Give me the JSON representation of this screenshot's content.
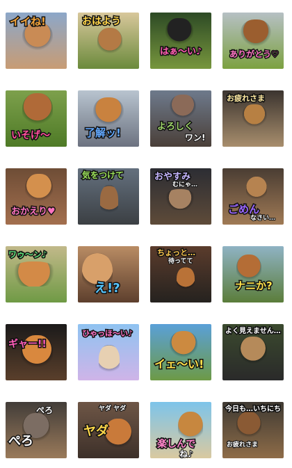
{
  "stickers": [
    {
      "text": "イイね!",
      "color": "#f3a43b",
      "bg": "linear-gradient(#8ca7c9,#c89c74)",
      "dogColor": "#c98b55"
    },
    {
      "text": "おはよう",
      "color": "#ffd54a",
      "bg": "linear-gradient(#d8c79b,#6b8a3c)",
      "dogColor": "#b47a45"
    },
    {
      "text": "はぁ〜い♪",
      "color": "#ff5db1",
      "bg": "linear-gradient(#2d4a25,#77963d)",
      "dogColor": "#222222"
    },
    {
      "text": "ありがとう♡",
      "color": "#ff75c5",
      "bg": "linear-gradient(#b6c0c4,#7ca140)",
      "dogColor": "#9b5e2f"
    },
    {
      "text": "いそげ〜",
      "color": "#ff4f9b",
      "bg": "linear-gradient(#7da04c,#4e7a26)",
      "dogColor": "#b06a38"
    },
    {
      "text": "了解ッ!",
      "color": "#62a8ff",
      "bg": "linear-gradient(#b8c4cf,#6c7280)",
      "dogColor": "#c9823f"
    },
    {
      "text": "よろしく",
      "sub": "ワン!",
      "color": "#9fd66a",
      "bg": "linear-gradient(#6e7a8c,#4a3f38)",
      "dogColor": "#8b6a58"
    },
    {
      "text": "お疲れさま",
      "color": "#ffeaa2",
      "bg": "linear-gradient(#3b342f,#a88e6d)",
      "dogColor": "#b78043"
    },
    {
      "text": "おかえり♥",
      "color": "#ff73c0",
      "bg": "linear-gradient(#6e4d36,#a36f4e)",
      "dogColor": "#d4904d"
    },
    {
      "text": "気をつけて",
      "color": "#9de35b",
      "bg": "linear-gradient(#64707e,#3b3f43)",
      "dogColor": "#9a6a42"
    },
    {
      "text": "おやすみ",
      "sub": "むにゃ…",
      "color": "#c5b5ff",
      "bg": "linear-gradient(#2c2d33,#5e4b39)",
      "dogColor": "#a68262"
    },
    {
      "text": "ごめん",
      "sub": "なさい…",
      "color": "#9a66ff",
      "bg": "linear-gradient(#4a3d33,#a07a55)",
      "dogColor": "#b68350"
    },
    {
      "text": "ワゥ〜ン♪",
      "color": "#5fe07a",
      "bg": "linear-gradient(#c2b98a,#6f9a45)",
      "dogColor": "#d38a47"
    },
    {
      "text": "え!?",
      "color": "#57c6ff",
      "bg": "linear-gradient(#b98c64,#5d3f2d)",
      "dogColor": "#d8a06a"
    },
    {
      "text": "ちょっと…",
      "sub": "待ってて",
      "color": "#ffc94d",
      "bg": "linear-gradient(#5b3c2c,#25221f)",
      "dogColor": "#b97237"
    },
    {
      "text": "ナニか?",
      "color": "#ffe24a",
      "bg": "linear-gradient(#8fb3c4,#5b7d3a)",
      "dogColor": "#b46d36"
    },
    {
      "text": "ギャー!!",
      "color": "#ff5db9",
      "bg": "linear-gradient(#1b1a1a,#5a3f2b)",
      "dogColor": "#d9883e"
    },
    {
      "text": "ひゃっほ〜い♪",
      "color": "#ff73c7",
      "bg": "linear-gradient(#8fc3f1,#cfb4e8)",
      "dogColor": "#e7d0b2"
    },
    {
      "text": "イェ〜い!",
      "color": "#ffe14a",
      "bg": "linear-gradient(#5aa0d8,#6d9a46)",
      "dogColor": "#cc8a40"
    },
    {
      "text": "よく見えません…",
      "color": "#ffffff",
      "bg": "linear-gradient(#3b4a2e,#2a2a2a)",
      "dogColor": "#b58a5a"
    },
    {
      "text": "ぺろ",
      "sub": "ぺろ",
      "color": "#ffffff",
      "bg": "linear-gradient(#423d39,#9a7a5a)",
      "dogColor": "#7c6d63"
    },
    {
      "text": "ヤダ",
      "sub": "ヤダ ヤダ",
      "color": "#ffd84a",
      "bg": "linear-gradient(#6e5646,#3d3029)",
      "dogColor": "#c97a3a"
    },
    {
      "text": "楽しんで",
      "sub": "ね♪",
      "color": "#ff85cb",
      "bg": "linear-gradient(#7dc4ea,#d9c9a0)",
      "dogColor": "#c7873f"
    },
    {
      "text": "今日も…いちにち",
      "sub": "お疲れさま",
      "color": "#ffffff",
      "bg": "linear-gradient(#3f3a33,#8e6c48)",
      "dogColor": "#8a5a34"
    }
  ]
}
